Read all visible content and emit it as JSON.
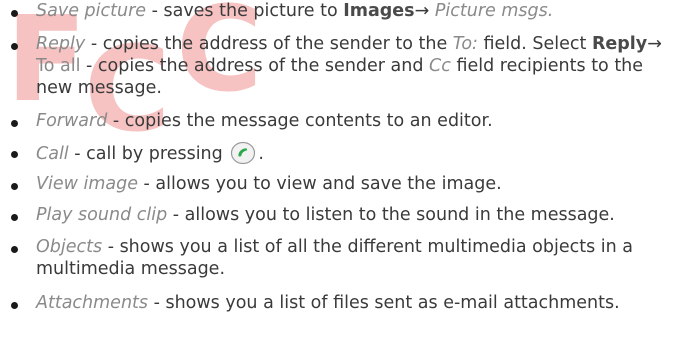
{
  "watermark": {
    "text": "FCC"
  },
  "items": [
    {
      "term": "Save picture",
      "desc": " - saves the picture to ",
      "bold": "Images",
      "arrow": "→ ",
      "italic_tail": "Picture msgs."
    },
    {
      "term": "Reply",
      "desc": " - copies the address of the sender to the ",
      "italic_mid": "To:",
      "desc2": " field. Select ",
      "bold": "Reply",
      "arrow": "→",
      "line2_plain": "To all",
      "line2_desc": " - copies the address of the sender and ",
      "line2_italic": "Cc",
      "line2_desc2": " field recipients to the",
      "line3": "new message."
    },
    {
      "term": "Forward",
      "desc": " - copies the message contents to an editor."
    },
    {
      "term": "Call",
      "desc": " - call by pressing",
      "tail": "."
    },
    {
      "term": "View image",
      "desc": " - allows you to view and save the image."
    },
    {
      "term": "Play sound clip",
      "desc": " - allows you to listen to the sound in the message."
    },
    {
      "term": "Objects",
      "desc": " - shows you a list of all the different multimedia objects in a",
      "line2": "multimedia message."
    },
    {
      "term": "Attachments",
      "desc": " - shows you a list of files sent as e-mail attachments."
    }
  ],
  "icons": {
    "call_key": "call-key-icon",
    "bullet": "bullet-icon"
  },
  "colors": {
    "watermark": "#f6c2c2",
    "term": "#8a8a8a",
    "body": "#3a3a3a",
    "call_key_green": "#2aa84a"
  }
}
